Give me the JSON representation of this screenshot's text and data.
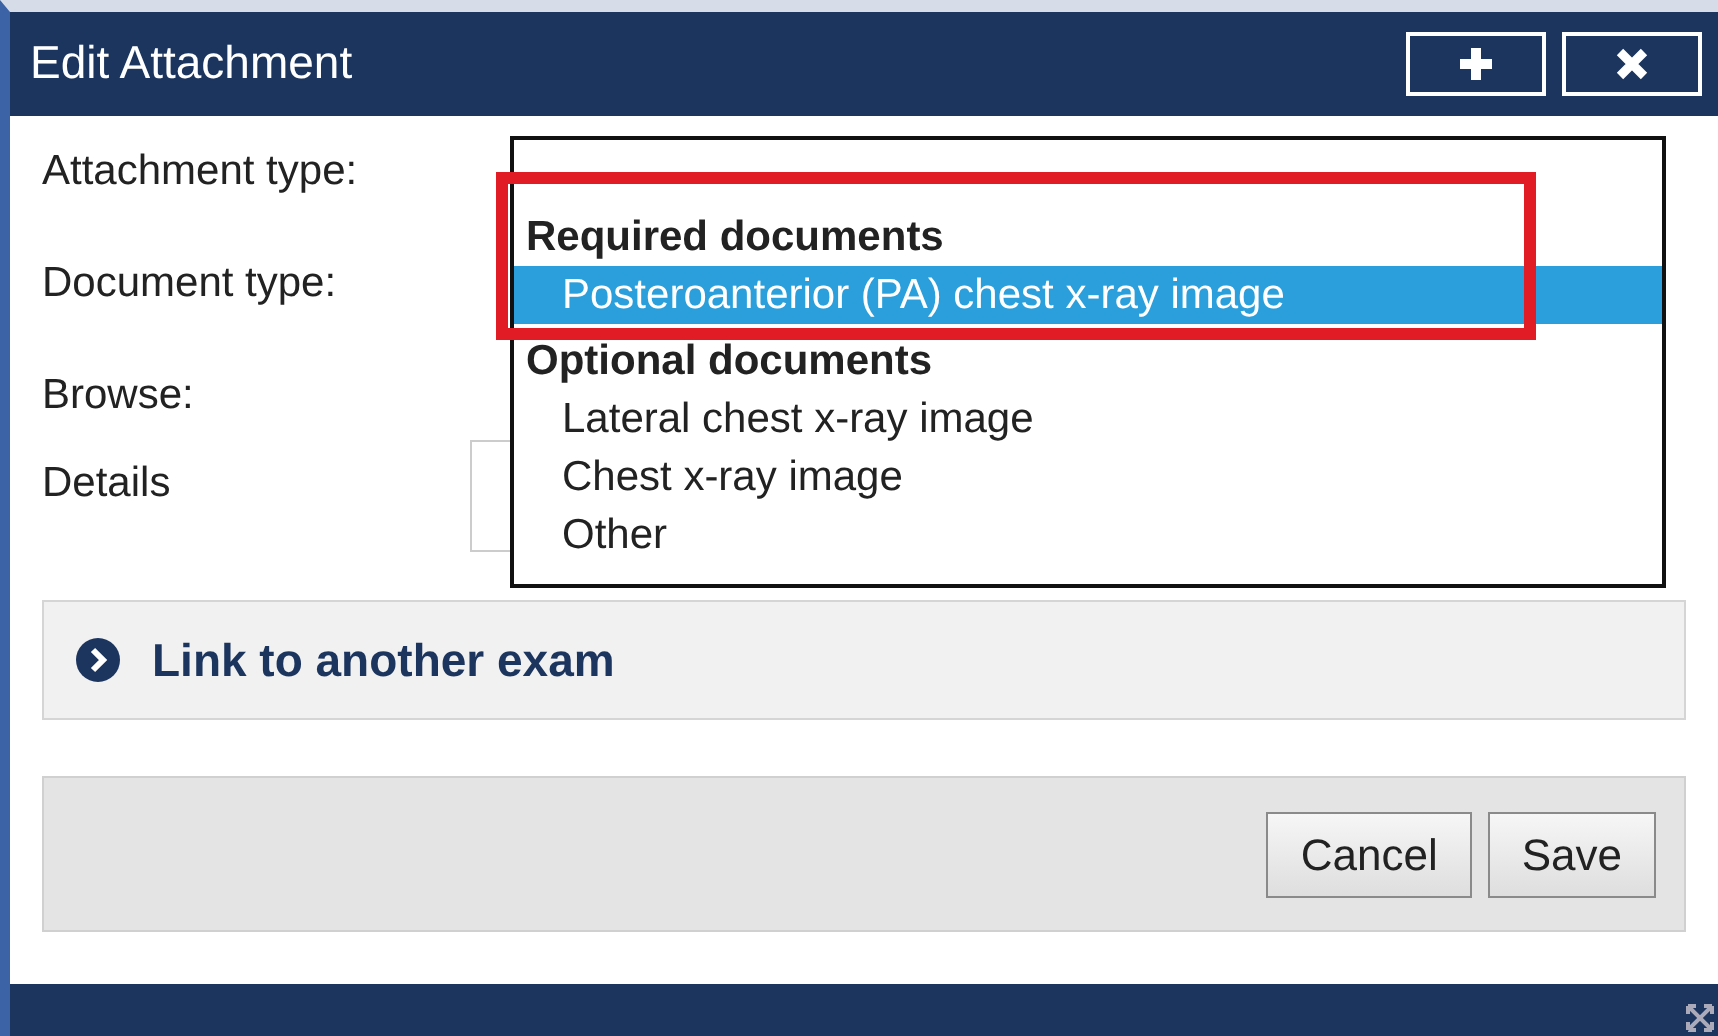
{
  "window": {
    "title": "Edit Attachment"
  },
  "title_buttons": [
    {
      "kind": "maximize"
    },
    {
      "kind": "close"
    }
  ],
  "fields": [
    {
      "label": "Attachment type:"
    },
    {
      "label": "Document type:"
    },
    {
      "label": "Browse:"
    },
    {
      "label": "Details",
      "kind": "textarea"
    }
  ],
  "dropdown": {
    "groups": [
      {
        "label": "Required documents",
        "options": [
          {
            "label": "Posteroanterior (PA) chest x-ray image",
            "selected": true
          }
        ]
      },
      {
        "label": "Optional documents",
        "options": [
          {
            "label": "Lateral chest x-ray image",
            "selected": false
          },
          {
            "label": "Chest x-ray image",
            "selected": false
          },
          {
            "label": "Other",
            "selected": false
          }
        ]
      }
    ]
  },
  "link_panel": {
    "label": "Link to another exam"
  },
  "buttons": [
    "Cancel",
    "Save"
  ]
}
